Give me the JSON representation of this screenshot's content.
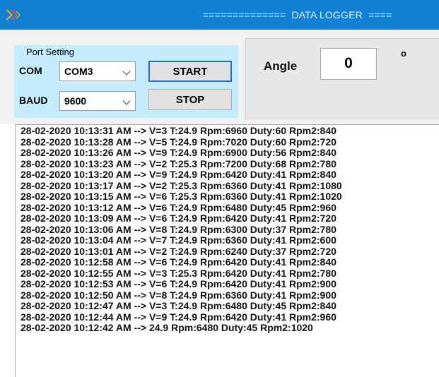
{
  "titlebar": {
    "title": "==============  DATA LOGGER  ====",
    "icon": "double-chevron-icon"
  },
  "port_setting": {
    "group_label": "Port Setting",
    "com_label": "COM",
    "com_value": "COM3",
    "baud_label": "BAUD",
    "baud_value": "9600",
    "start_label": "START",
    "stop_label": "STOP"
  },
  "angle": {
    "label": "Angle",
    "value": "0",
    "unit": "o"
  },
  "log": {
    "lines": [
      "28-02-2020 10:13:31 AM --> V=3 T:24.9 Rpm:6960 Duty:60 Rpm2:840",
      "28-02-2020 10:13:28 AM --> V=5 T:24.9 Rpm:7020 Duty:60 Rpm2:720",
      "28-02-2020 10:13:26 AM --> V=9 T:24.9 Rpm:6900 Duty:56 Rpm2:840",
      "28-02-2020 10:13:23 AM --> V=2 T:25.3 Rpm:7200 Duty:68 Rpm2:780",
      "28-02-2020 10:13:20 AM --> V=9 T:24.9 Rpm:6420 Duty:41 Rpm2:840",
      "28-02-2020 10:13:17 AM --> V=2 T:25.3 Rpm:6360 Duty:41 Rpm2:1080",
      "28-02-2020 10:13:15 AM --> V=6 T:25.3 Rpm:6360 Duty:41 Rpm2:1020",
      "28-02-2020 10:13:12 AM --> V=6 T:24.9 Rpm:6480 Duty:45 Rpm2:960",
      "28-02-2020 10:13:09 AM --> V=6 T:24.9 Rpm:6420 Duty:41 Rpm2:720",
      "28-02-2020 10:13:06 AM --> V=8 T:24.9 Rpm:6300 Duty:37 Rpm2:780",
      "28-02-2020 10:13:04 AM --> V=7 T:24.9 Rpm:6360 Duty:41 Rpm2:600",
      "28-02-2020 10:13:01 AM --> V=2 T:24.9 Rpm:6240 Duty:37 Rpm2:720",
      "28-02-2020 10:12:58 AM --> V=6 T:24.9 Rpm:6420 Duty:41 Rpm2:840",
      "28-02-2020 10:12:55 AM --> V=3 T:25.3 Rpm:6420 Duty:41 Rpm2:780",
      "28-02-2020 10:12:53 AM --> V=6 T:24.9 Rpm:6420 Duty:41 Rpm2:900",
      "28-02-2020 10:12:50 AM --> V=8 T:24.9 Rpm:6360 Duty:41 Rpm2:900",
      "28-02-2020 10:12:47 AM --> V=3 T:24.9 Rpm:6480 Duty:45 Rpm2:840",
      "28-02-2020 10:12:44 AM --> V=9 T:24.9 Rpm:6420 Duty:41 Rpm2:960",
      "28-02-2020 10:12:42 AM --> 24.9 Rpm:6480 Duty:45 Rpm2:1020"
    ]
  },
  "colors": {
    "titlebar": "#1281d3",
    "port_group": "#c5ecfb",
    "focus_border": "#1e6ccf"
  }
}
